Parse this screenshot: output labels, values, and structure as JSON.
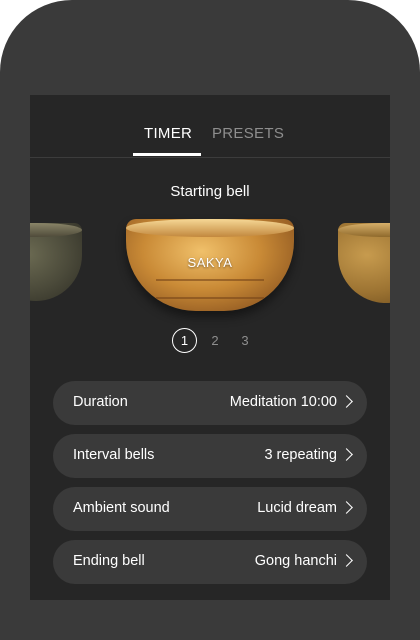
{
  "tabs": [
    {
      "label": "TIMER",
      "active": true
    },
    {
      "label": "PRESETS",
      "active": false
    }
  ],
  "bell_section": {
    "title": "Starting bell",
    "selected_bell": "SAKYA",
    "pages": [
      "1",
      "2",
      "3"
    ],
    "current_page": 1
  },
  "settings": [
    {
      "label": "Duration",
      "value": "Meditation 10:00"
    },
    {
      "label": "Interval bells",
      "value": "3 repeating"
    },
    {
      "label": "Ambient sound",
      "value": "Lucid dream"
    },
    {
      "label": "Ending bell",
      "value": "Gong hanchi"
    }
  ],
  "colors": {
    "frame": "#3a3a3a",
    "screen_bg": "#262626",
    "row_bg": "#3a3a3a",
    "text": "#ffffff",
    "muted": "#8e8e8e"
  }
}
